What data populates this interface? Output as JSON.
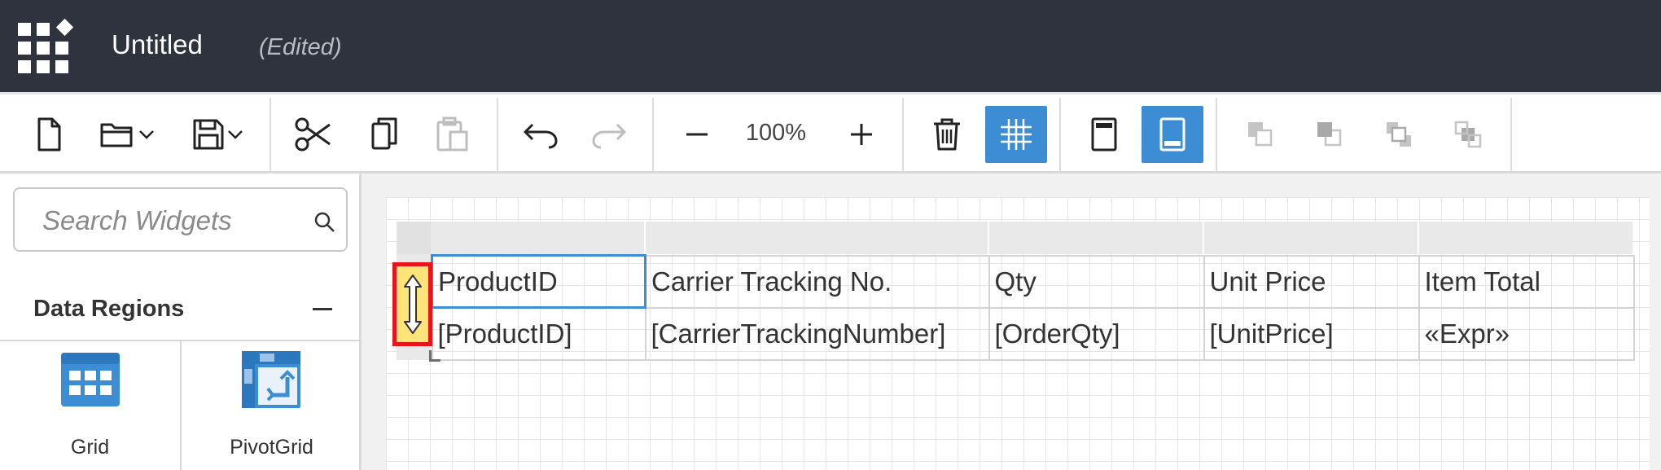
{
  "titlebar": {
    "title": "Untitled",
    "status": "(Edited)",
    "icon": "apps-grid-icon"
  },
  "toolbar": {
    "zoom_level": "100%",
    "buttons": [
      {
        "name": "new-file",
        "icon": "new-file-icon"
      },
      {
        "name": "open",
        "icon": "folder-icon"
      },
      {
        "name": "save",
        "icon": "save-icon"
      },
      {
        "name": "cut",
        "icon": "scissors-icon"
      },
      {
        "name": "copy",
        "icon": "copy-icon"
      },
      {
        "name": "paste",
        "icon": "paste-icon",
        "disabled": true
      },
      {
        "name": "undo",
        "icon": "undo-icon"
      },
      {
        "name": "redo",
        "icon": "redo-icon",
        "disabled": true
      },
      {
        "name": "zoom-out",
        "icon": "minus-icon"
      },
      {
        "name": "zoom-in",
        "icon": "plus-icon"
      },
      {
        "name": "delete",
        "icon": "trash-icon"
      },
      {
        "name": "grid-lines",
        "icon": "gridlines-icon",
        "active": true
      },
      {
        "name": "header-footer",
        "icon": "header-icon"
      },
      {
        "name": "page-layout",
        "icon": "footer-icon",
        "active": true
      },
      {
        "name": "bring-forward",
        "icon": "bring-forward-icon",
        "disabled": true
      },
      {
        "name": "send-backward",
        "icon": "send-backward-icon",
        "disabled": true
      },
      {
        "name": "bring-to-front",
        "icon": "bring-to-front-icon",
        "disabled": true
      },
      {
        "name": "send-to-back",
        "icon": "send-to-back-icon",
        "disabled": true
      }
    ]
  },
  "sidebar": {
    "search": {
      "placeholder": "Search Widgets",
      "value": ""
    },
    "section": {
      "title": "Data Regions",
      "collapse_symbol": "—"
    },
    "widgets": [
      {
        "label": "Grid",
        "icon": "grid-widget-icon"
      },
      {
        "label": "PivotGrid",
        "icon": "pivotgrid-widget-icon"
      }
    ]
  },
  "table": {
    "header_row": [
      "ProductID",
      "Carrier Tracking No.",
      "Qty",
      "Unit Price",
      "Item Total"
    ],
    "data_row": [
      "[ProductID]",
      "[CarrierTrackingNumber]",
      "[OrderQty]",
      "[UnitPrice]",
      "«Expr»"
    ]
  },
  "colors": {
    "titlebar_bg": "#2f333e",
    "accent": "#3c8dd4",
    "selection_border": "#e8141b",
    "selection_fill": "#ffe47a"
  }
}
